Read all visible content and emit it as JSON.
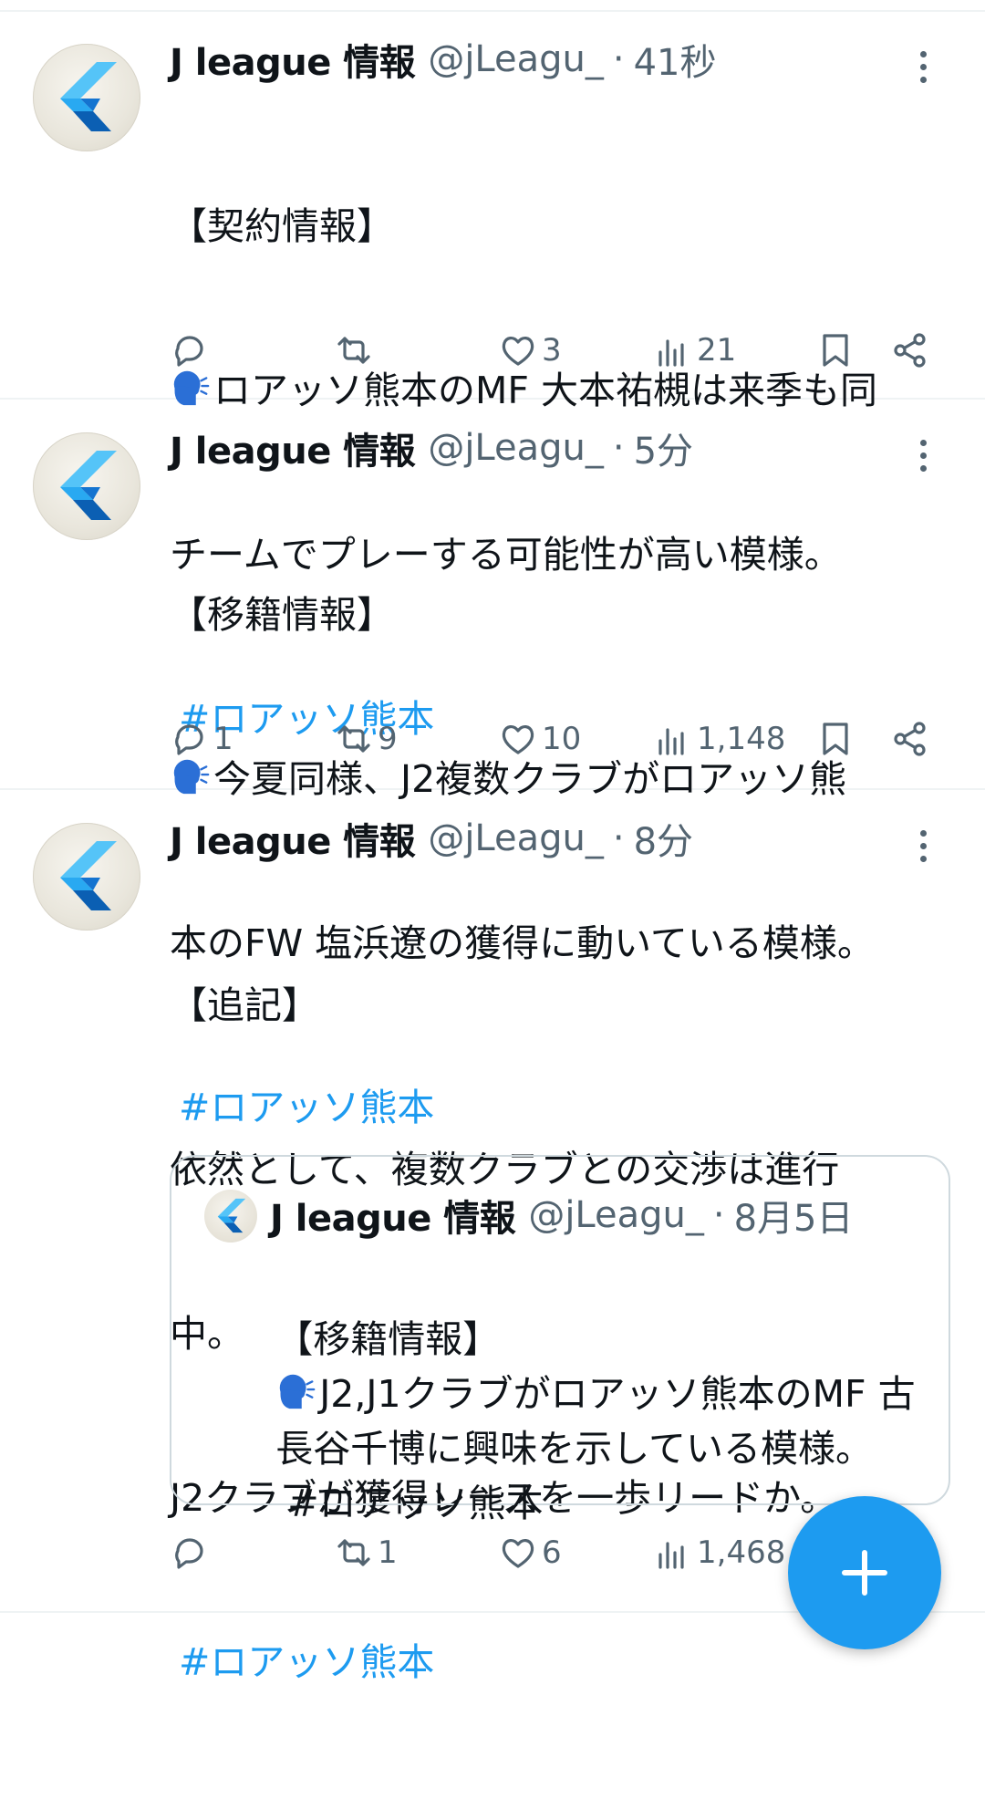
{
  "tweets": [
    {
      "name": "J league 情報",
      "handle": "@jLeagu_",
      "dot": "·",
      "time": "41秒",
      "lines": [
        "【契約情報】",
        "ロアッソ熊本のMF 大本祐槻は来季も同",
        "チームでプレーする可能性が高い模様。"
      ],
      "hashtag": "#ロアッソ熊本",
      "replies": "",
      "retweets": "",
      "likes": "3",
      "views": "21"
    },
    {
      "name": "J league 情報",
      "handle": "@jLeagu_",
      "dot": "·",
      "time": "5分",
      "lines": [
        "【移籍情報】",
        "今夏同様、J2複数クラブがロアッソ熊",
        "本のFW 塩浜遼の獲得に動いている模様。"
      ],
      "hashtag": "#ロアッソ熊本",
      "replies": "1",
      "retweets": "9",
      "likes": "10",
      "views": "1,148"
    },
    {
      "name": "J league 情報",
      "handle": "@jLeagu_",
      "dot": "·",
      "time": "8分",
      "lines": [
        "【追記】",
        "依然として、複数クラブとの交渉は進行",
        "中。",
        "J2クラブが獲得レースを一歩リードか。"
      ],
      "hashtag": "#ロアッソ熊本",
      "replies": "",
      "retweets": "1",
      "likes": "6",
      "views": "1,468",
      "quote": {
        "name": "J league 情報",
        "handle": "@jLeagu_",
        "dot": "·",
        "time": "8月5日",
        "lines": [
          "【移籍情報】",
          "J2,J1クラブがロアッソ熊本のMF 古",
          "長谷千博に興味を示している模様。",
          " #ロアッソ熊本"
        ]
      }
    }
  ],
  "colors": {
    "accent": "#1d9bf0",
    "muted": "#536471",
    "text": "#0f1419"
  },
  "icons": [
    "reply-icon",
    "retweet-icon",
    "like-icon",
    "views-icon",
    "bookmark-icon",
    "share-icon",
    "more-icon",
    "speaking-head-icon",
    "compose-plus-icon"
  ]
}
